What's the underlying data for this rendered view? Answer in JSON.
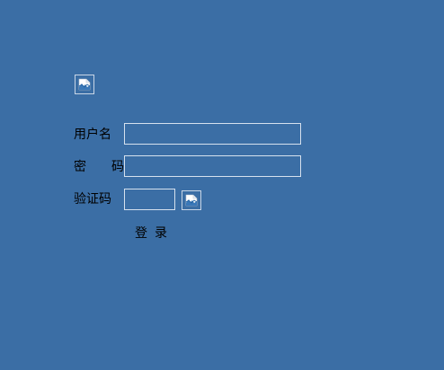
{
  "form": {
    "header_image": {
      "icon": "broken-image-icon"
    },
    "username": {
      "label": "用户名",
      "value": "",
      "placeholder": ""
    },
    "password": {
      "label": "密　　码",
      "value": "",
      "placeholder": ""
    },
    "captcha": {
      "label": "验证码",
      "value": "",
      "placeholder": "",
      "image_icon": "broken-image-icon"
    },
    "login_button_label": "登录"
  },
  "colors": {
    "background": "#3b6ea5",
    "field_border": "#d6e1ee",
    "text": "#000000"
  }
}
